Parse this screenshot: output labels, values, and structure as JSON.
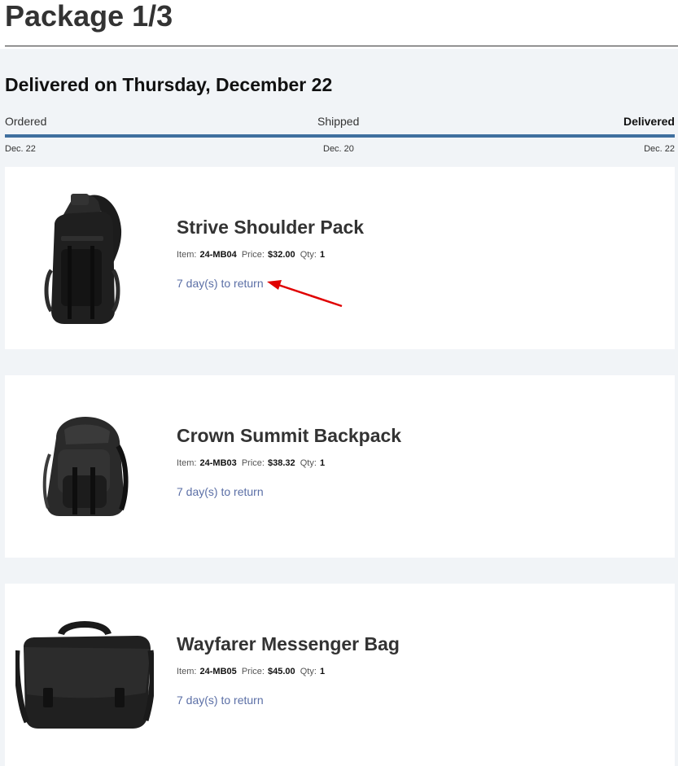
{
  "package": {
    "title": "Package 1/3",
    "delivery_heading": "Delivered on Thursday, December 22"
  },
  "tracking": {
    "progress_percent": 100,
    "accent_color": "#3f6f9f",
    "steps": [
      {
        "label": "Ordered",
        "date": "Dec. 22"
      },
      {
        "label": "Shipped",
        "date": "Dec. 20"
      },
      {
        "label": "Delivered",
        "date": "Dec. 22",
        "active": true
      }
    ]
  },
  "meta_labels": {
    "item": "Item:",
    "price": "Price:",
    "qty": "Qty:"
  },
  "items": [
    {
      "name": "Strive Shoulder Pack",
      "sku": "24-MB04",
      "price": "$32.00",
      "qty": "1",
      "return_text": "7 day(s) to return",
      "image": "sling-backpack-image"
    },
    {
      "name": "Crown Summit Backpack",
      "sku": "24-MB03",
      "price": "$38.32",
      "qty": "1",
      "return_text": "7 day(s) to return",
      "image": "backpack-image"
    },
    {
      "name": "Wayfarer Messenger Bag",
      "sku": "24-MB05",
      "price": "$45.00",
      "qty": "1",
      "return_text": "7 day(s) to return",
      "image": "messenger-bag-image"
    }
  ],
  "annotation": {
    "icon": "red-arrow-icon",
    "color": "#e00000"
  }
}
